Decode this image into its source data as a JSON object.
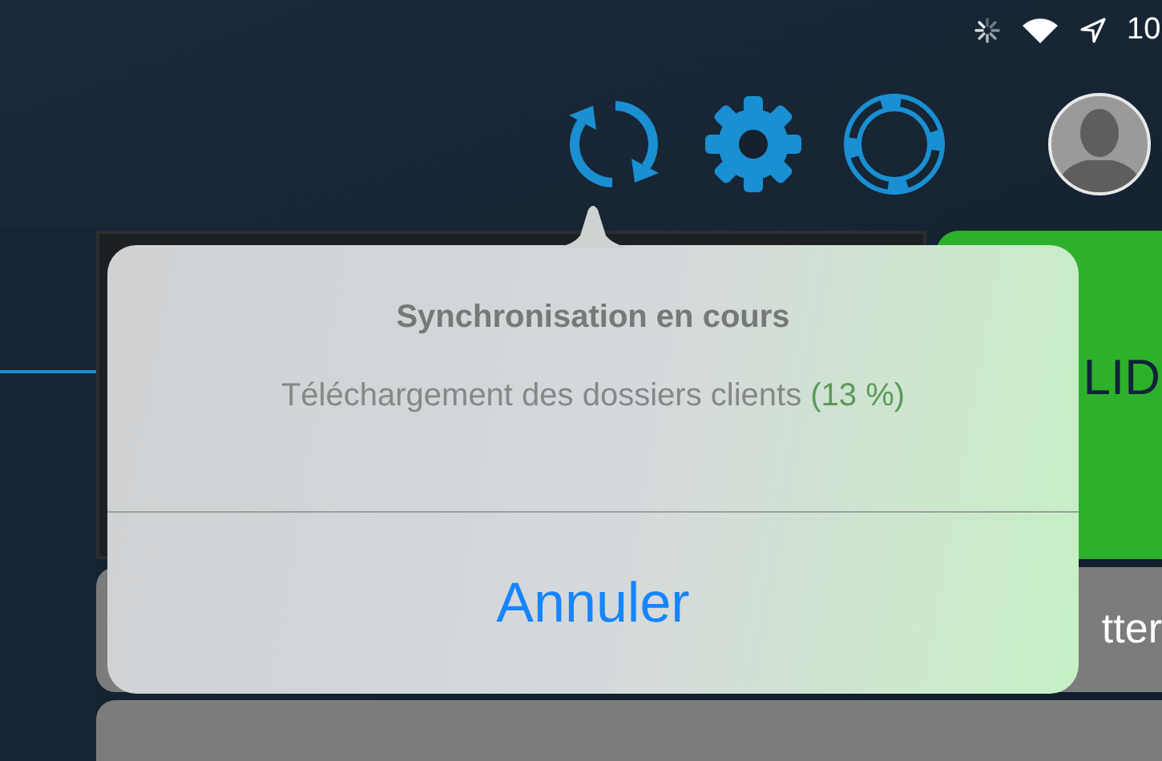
{
  "status_bar": {
    "time": "10"
  },
  "toolbar": {
    "buttons": [
      {
        "kind": "sync"
      },
      {
        "kind": "settings"
      },
      {
        "kind": "help"
      }
    ]
  },
  "background": {
    "green_button": "LID",
    "gray_button": "tter"
  },
  "popover": {
    "title": "Synchronisation en cours",
    "message": "Téléchargement des dossiers clients",
    "progress": "(13 %)",
    "buttons": [
      "Annuler"
    ]
  }
}
